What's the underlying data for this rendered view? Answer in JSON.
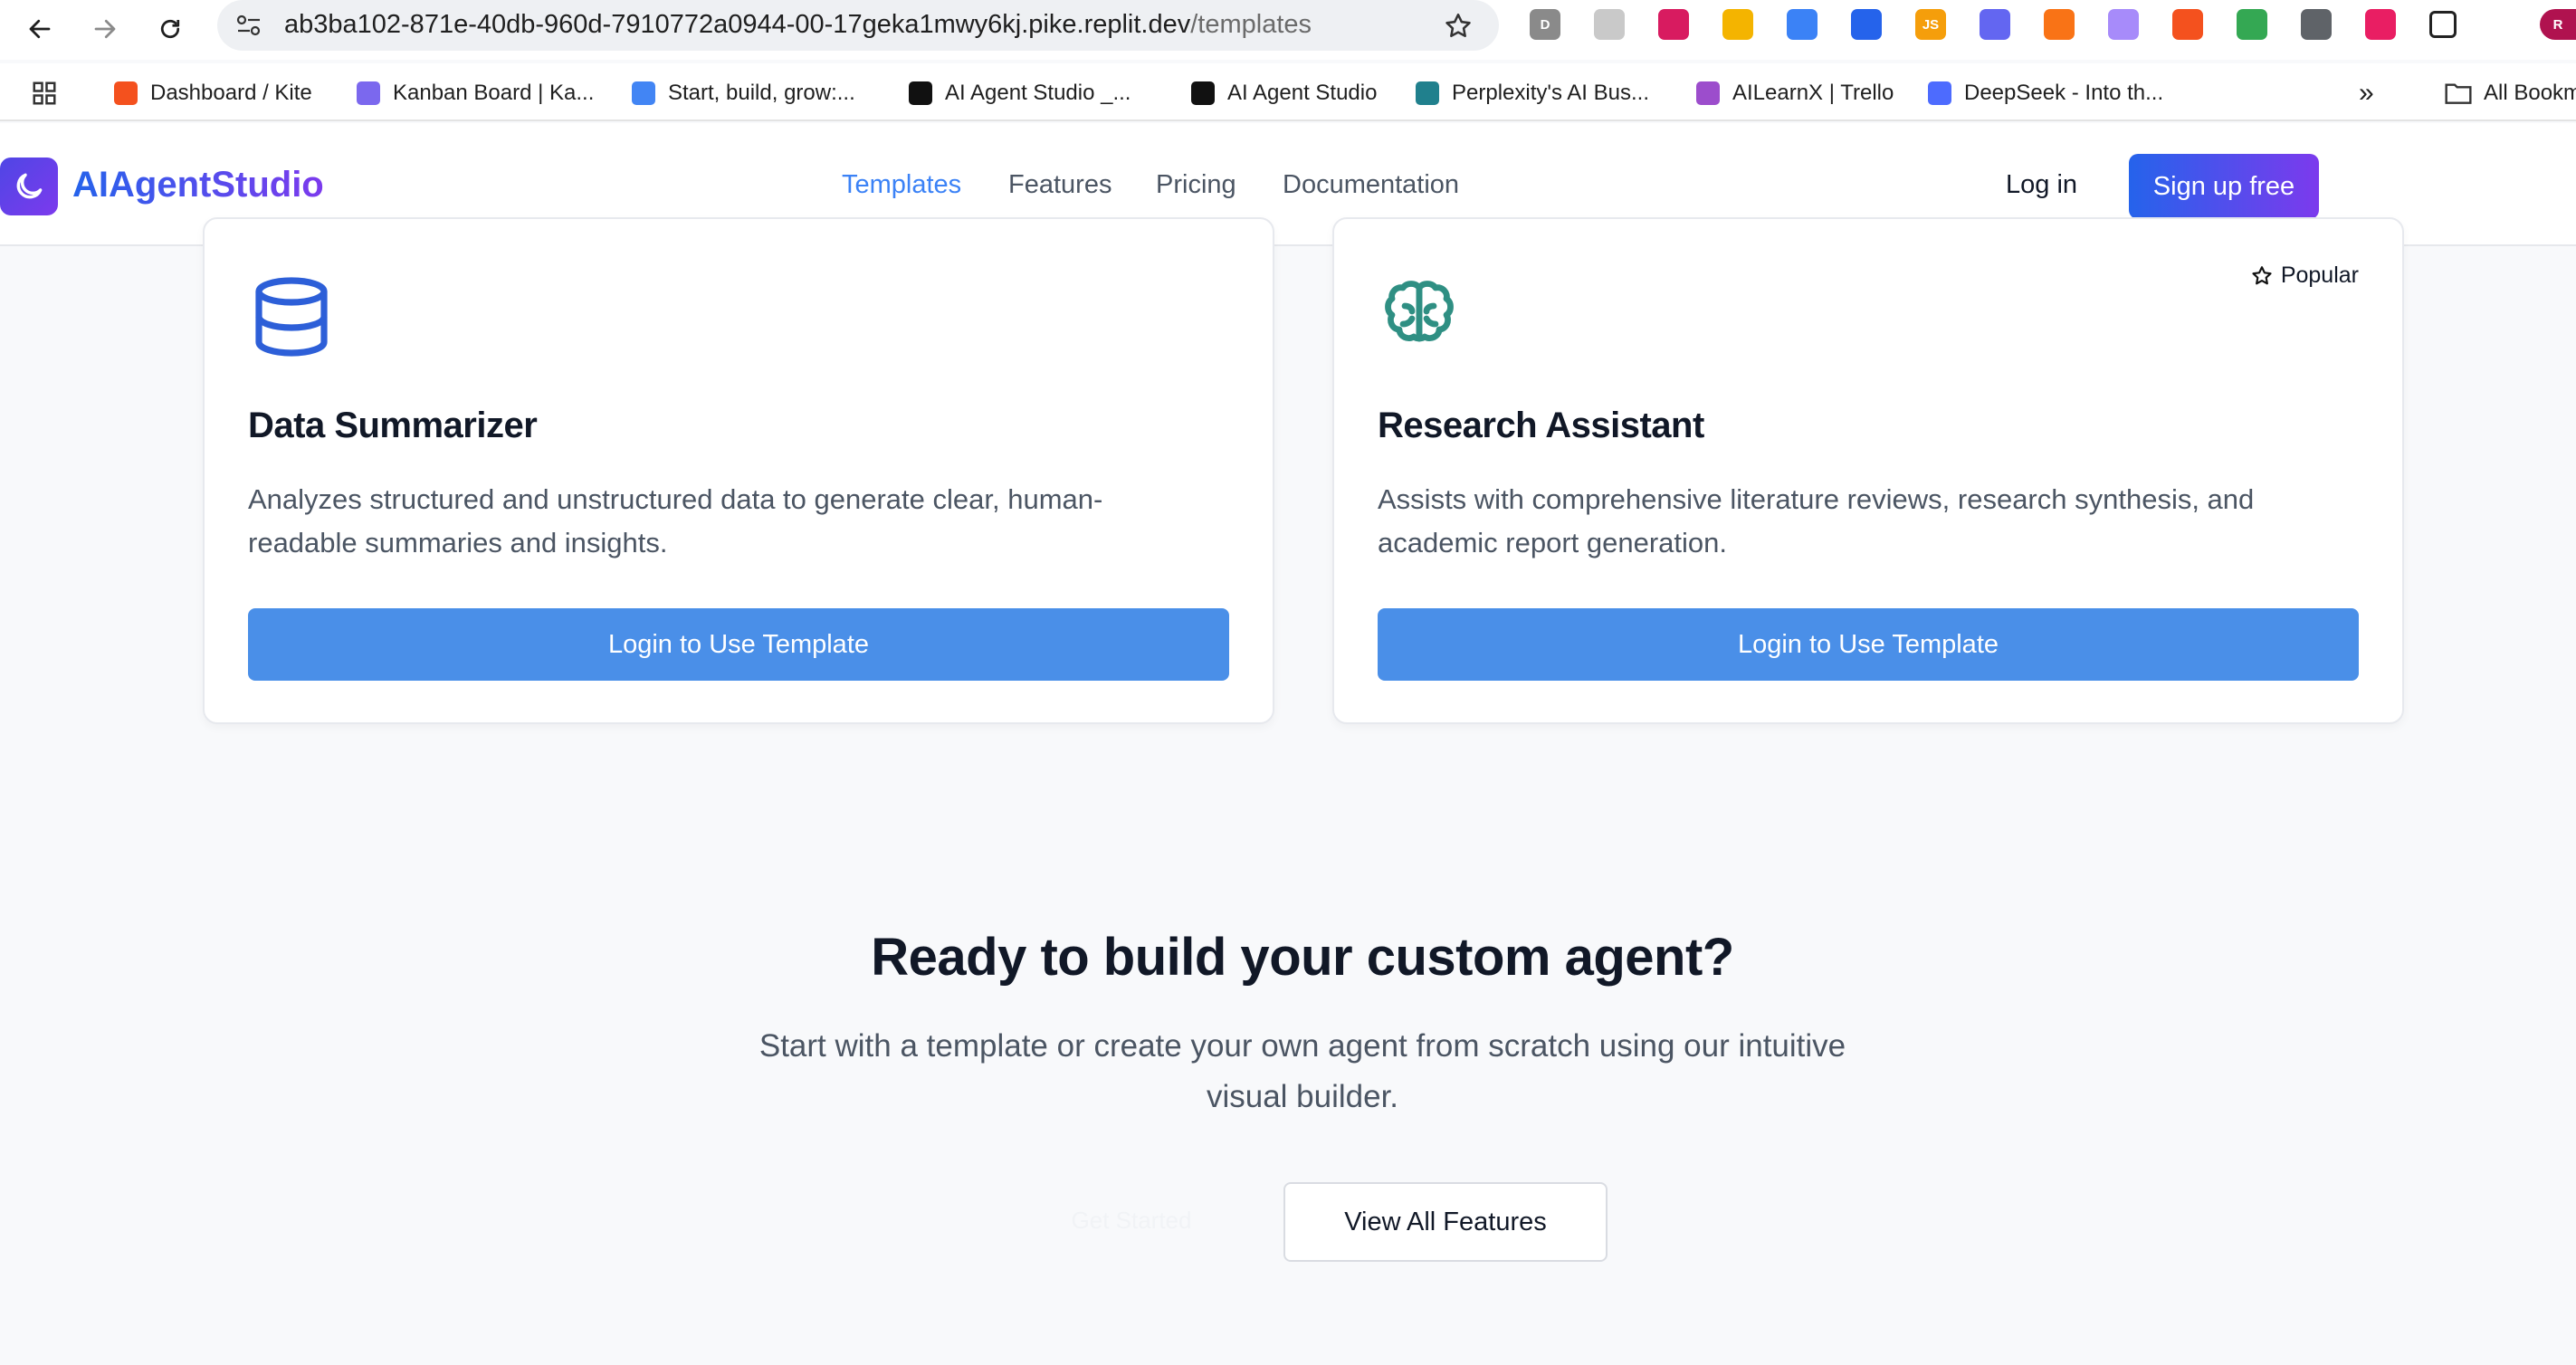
{
  "browser": {
    "url_host": "ab3ba102-871e-40db-960d-7910772a0944-00-17geka1mwy6kj.pike.replit.dev",
    "url_path": "/templates",
    "extensions": [
      {
        "icon": "d-extension-icon",
        "text": "D",
        "color": "#8a8a8a"
      },
      {
        "icon": "image-extension-icon",
        "text": "",
        "color": "#c9c9c9"
      },
      {
        "icon": "play-extension-icon",
        "text": "",
        "color": "#d81b60"
      },
      {
        "icon": "search-extension-icon",
        "text": "",
        "color": "#f4b400"
      },
      {
        "icon": "diamond-extension-icon",
        "text": "",
        "color": "#3b82f6"
      },
      {
        "icon": "tag-extension-icon",
        "text": "",
        "color": "#2563eb"
      },
      {
        "icon": "js-extension-icon",
        "text": "JS",
        "color": "#f59e0b"
      },
      {
        "icon": "grid-extension-icon",
        "text": "",
        "color": "#6366f1"
      },
      {
        "icon": "chess-extension-icon",
        "text": "",
        "color": "#f97316"
      },
      {
        "icon": "face-extension-icon",
        "text": "",
        "color": "#a78bfa"
      },
      {
        "icon": "brave-extension-icon",
        "text": "",
        "color": "#f4511e"
      },
      {
        "icon": "cart-extension-icon",
        "text": "",
        "color": "#34a853"
      },
      {
        "icon": "info-extension-icon",
        "text": "",
        "color": "#5f6368"
      },
      {
        "icon": "color-extension-icon",
        "text": "",
        "color": "#e91e63"
      },
      {
        "icon": "puzzle-icon",
        "text": "",
        "color": "#ffffff"
      }
    ],
    "profile_initial": "R",
    "bookmarks": [
      {
        "label": "Dashboard / Kite",
        "icon": "kite-icon",
        "color": "#f4511e"
      },
      {
        "label": "Kanban Board | Ka...",
        "icon": "clickup-icon",
        "color": "#7b68ee"
      },
      {
        "label": "Start, build, grow:...",
        "icon": "google-icon",
        "color": "#4285f4"
      },
      {
        "label": "AI Agent Studio _...",
        "icon": "openai-icon",
        "color": "#111111"
      },
      {
        "label": "AI Agent Studio",
        "icon": "notion-icon",
        "color": "#111111"
      },
      {
        "label": "Perplexity's AI Bus...",
        "icon": "perplexity-icon",
        "color": "#20808d"
      },
      {
        "label": "AILearnX | Trello",
        "icon": "trello-icon",
        "color": "#9c4dcc"
      },
      {
        "label": "DeepSeek - Into th...",
        "icon": "deepseek-icon",
        "color": "#4d6bfe"
      }
    ],
    "more_bookmarks": "»",
    "all_bookmarks": "All Bookm"
  },
  "header": {
    "brand": "AIAgentStudio",
    "nav": [
      {
        "label": "Templates",
        "active": true
      },
      {
        "label": "Features",
        "active": false
      },
      {
        "label": "Pricing",
        "active": false
      },
      {
        "label": "Documentation",
        "active": false
      }
    ],
    "login": "Log in",
    "signup": "Sign up free"
  },
  "cards": [
    {
      "icon": "database-icon",
      "icon_color": "#2d5fd8",
      "title": "Data Summarizer",
      "description": "Analyzes structured and unstructured data to generate clear, human-readable summaries and insights.",
      "button": "Login to Use Template"
    },
    {
      "icon": "brain-icon",
      "icon_color": "#2f8f83",
      "badge": "Popular",
      "title": "Research Assistant",
      "description": "Assists with comprehensive literature reviews, research synthesis, and academic report generation.",
      "button": "Login to Use Template"
    }
  ],
  "cta": {
    "title": "Ready to build your custom agent?",
    "subtitle": "Start with a template or create your own agent from scratch using our intuitive visual builder.",
    "ghost_button": "Get Started",
    "outline_button": "View All Features"
  }
}
